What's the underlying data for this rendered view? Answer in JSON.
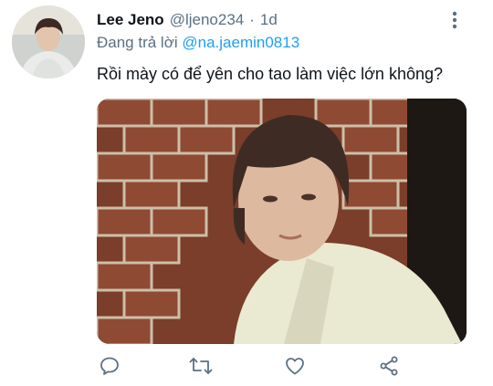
{
  "tweet": {
    "display_name": "Lee Jeno",
    "handle": "@ljeno234",
    "separator": "·",
    "time": "1d",
    "reply_prefix": "Đang trả lời",
    "reply_to": "@na.jaemin0813",
    "text": "Rồi mày có để yên cho tao làm việc lớn không?"
  },
  "icons": {
    "more": "more-vertical-icon",
    "reply": "reply-icon",
    "retweet": "retweet-icon",
    "like": "heart-icon",
    "share": "share-icon"
  },
  "colors": {
    "link": "#1da1f2",
    "secondary_text": "#5b7083",
    "primary_text": "#0f1419"
  }
}
